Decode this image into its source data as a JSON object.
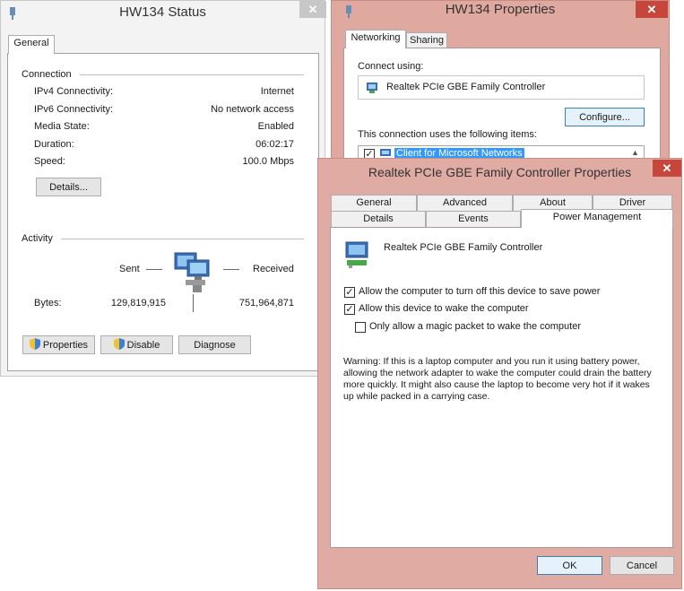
{
  "status_window": {
    "title": "HW134 Status",
    "close_glyph": "✕",
    "tab_general": "General",
    "connection_heading": "Connection",
    "rows": [
      {
        "label": "IPv4 Connectivity:",
        "value": "Internet"
      },
      {
        "label": "IPv6 Connectivity:",
        "value": "No network access"
      },
      {
        "label": "Media State:",
        "value": "Enabled"
      },
      {
        "label": "Duration:",
        "value": "06:02:17"
      },
      {
        "label": "Speed:",
        "value": "100.0 Mbps"
      }
    ],
    "details_button": "Details...",
    "activity_heading": "Activity",
    "sent_label": "Sent",
    "received_label": "Received",
    "bytes_label": "Bytes:",
    "bytes_sent": "129,819,915",
    "bytes_received": "751,964,871",
    "properties_button": "Properties",
    "disable_button": "Disable",
    "diagnose_button": "Diagnose"
  },
  "properties_window": {
    "title": "HW134 Properties",
    "close_glyph": "✕",
    "tab_networking": "Networking",
    "tab_sharing": "Sharing",
    "connect_using_label": "Connect using:",
    "adapter_name": "Realtek PCIe GBE Family Controller",
    "configure_button": "Configure...",
    "items_label": "This connection uses the following items:",
    "first_item": "Client for Microsoft Networks",
    "first_item_checked": true
  },
  "adapter_window": {
    "title": "Realtek PCIe GBE Family Controller Properties",
    "close_glyph": "✕",
    "tabs_row1": [
      "General",
      "Advanced",
      "About",
      "Driver"
    ],
    "tabs_row2": [
      "Details",
      "Events",
      "Power Management"
    ],
    "active_tab": "Power Management",
    "device_name": "Realtek PCIe GBE Family Controller",
    "options": [
      {
        "label": "Allow the computer to turn off this device to save power",
        "checked": true
      },
      {
        "label": "Allow this device to wake the computer",
        "checked": true
      },
      {
        "label": "Only allow a magic packet to wake the computer",
        "checked": false
      }
    ],
    "warning": "Warning: If this is a laptop computer and you run it using battery power, allowing the network adapter to wake the computer could drain the battery more quickly. It might also cause the laptop to become very hot if it wakes up while packed in a carrying case.",
    "ok_button": "OK",
    "cancel_button": "Cancel"
  },
  "colors": {
    "status_frame": "#f3f3f3",
    "properties_frame": "#dfa9a0",
    "adapter_frame": "#e0aba2",
    "close_red": "#c7463b",
    "selection_blue": "#3399ff",
    "accent_border": "#3c7fb1"
  }
}
